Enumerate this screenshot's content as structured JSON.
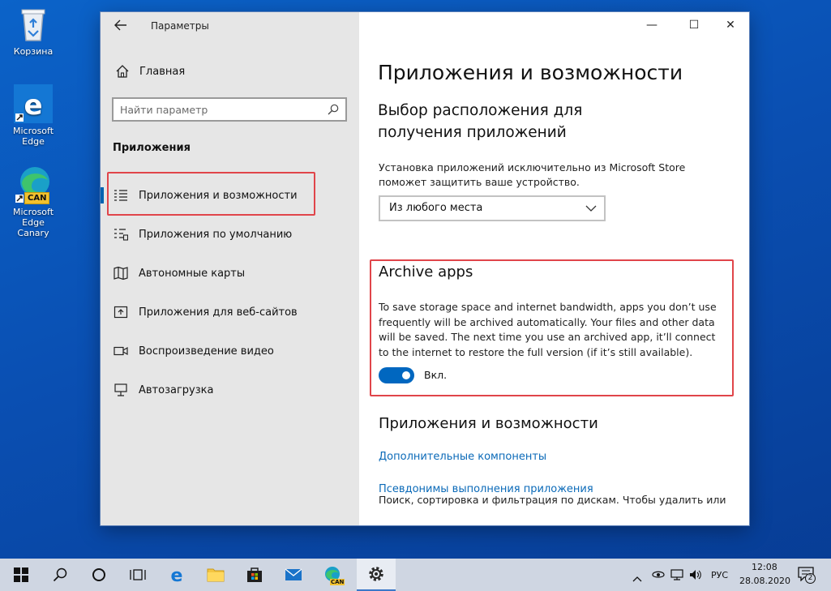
{
  "desktop": {
    "icons": [
      {
        "label": "Корзина"
      },
      {
        "label": "Microsoft\nEdge"
      },
      {
        "label": "Microsoft\nEdge Canary",
        "badge": "CAN"
      }
    ]
  },
  "window": {
    "title": "Параметры",
    "controls": {
      "minimize": "—",
      "maximize": "☐",
      "close": "✕"
    }
  },
  "sidebar": {
    "home_label": "Главная",
    "search_placeholder": "Найти параметр",
    "section_label": "Приложения",
    "items": [
      {
        "label": "Приложения и возможности",
        "icon": "apps-list-icon",
        "active": true
      },
      {
        "label": "Приложения по умолчанию",
        "icon": "default-apps-icon"
      },
      {
        "label": "Автономные карты",
        "icon": "map-icon"
      },
      {
        "label": "Приложения для веб-сайтов",
        "icon": "web-apps-icon"
      },
      {
        "label": "Воспроизведение видео",
        "icon": "video-icon"
      },
      {
        "label": "Автозагрузка",
        "icon": "startup-icon"
      }
    ]
  },
  "content": {
    "page_title": "Приложения и возможности",
    "install_section": {
      "heading": "Выбор расположения для получения приложений",
      "description": "Установка приложений исключительно из Microsoft Store поможет защитить ваше устройство.",
      "dropdown_value": "Из любого места"
    },
    "archive": {
      "heading": "Archive apps",
      "text": "To save storage space and internet bandwidth, apps you don’t use frequently will be archived automatically. Your files and other data will be saved. The next time you use an archived app, it’ll connect to the internet to restore the full version (if it’s still available).",
      "toggle_on": true,
      "toggle_label": "Вкл."
    },
    "features": {
      "heading": "Приложения и возможности",
      "links": [
        "Дополнительные компоненты",
        "Псевдонимы выполнения приложения"
      ],
      "bottom_text": "Поиск, сортировка и фильтрация по дискам. Чтобы удалить или"
    }
  },
  "taskbar": {
    "language": "РУС",
    "time": "12:08",
    "date": "28.08.2020",
    "notification_count": "2",
    "canary_badge": "CAN"
  },
  "colors": {
    "accent": "#0067c0",
    "link": "#0b6ab8",
    "highlight_box": "#e0454a",
    "sidebar_bg": "#e6e6e6"
  }
}
